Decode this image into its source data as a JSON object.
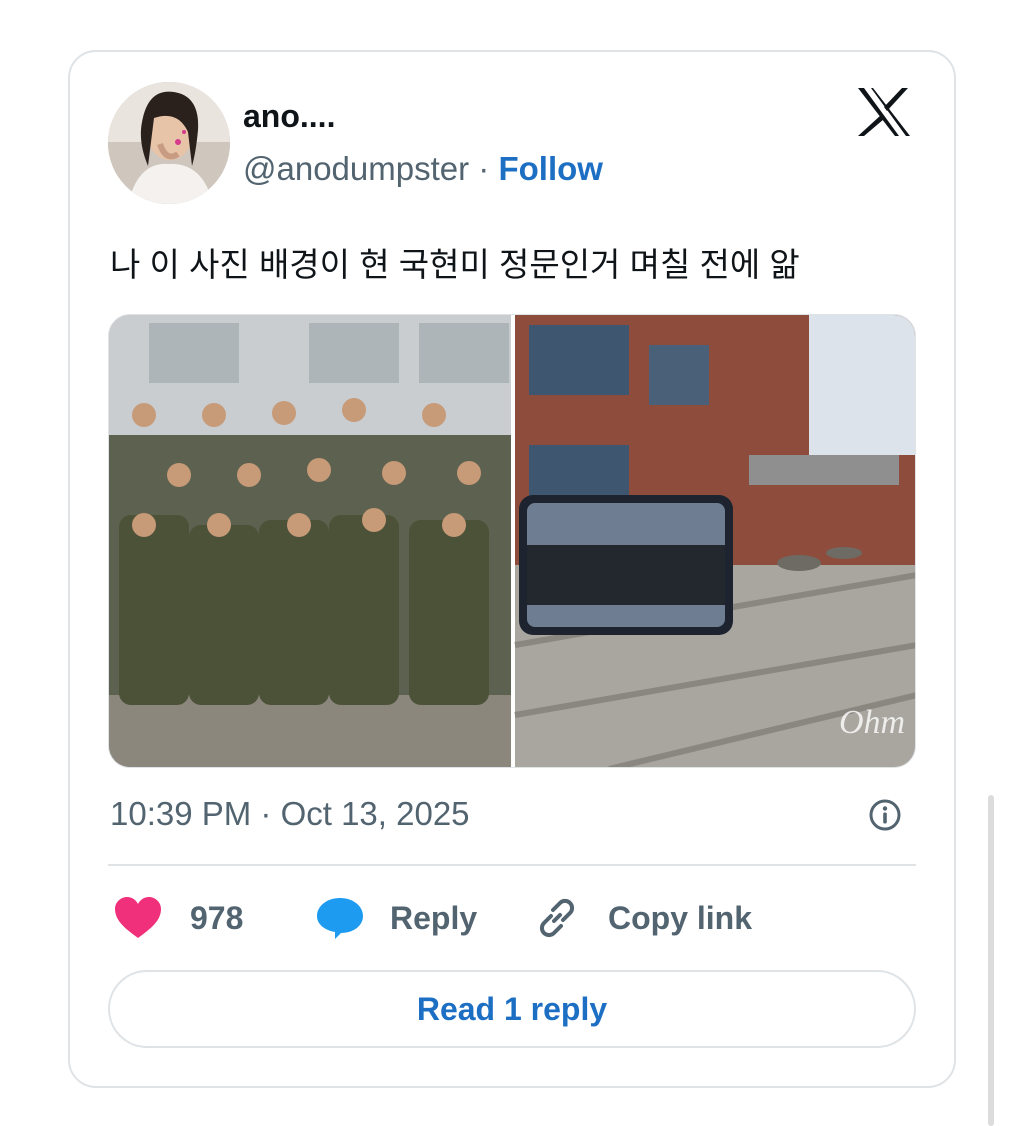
{
  "author": {
    "display_name": "ano....",
    "handle": "@anodumpster",
    "separator": "·",
    "follow_label": "Follow",
    "avatar_icon": "profile-photo"
  },
  "tweet": {
    "text": "나 이 사진 배경이 현 국현미 정문인거 며칠 전에 앎",
    "timestamp": "10:39 PM · Oct 13, 2025"
  },
  "media": {
    "watermark": "Ohm"
  },
  "actions": {
    "likes_count": "978",
    "reply_label": "Reply",
    "copy_link_label": "Copy link",
    "read_replies_label": "Read 1 reply"
  },
  "colors": {
    "accent": "#1d6fc4",
    "like": "#f0307a",
    "reply_icon": "#1d9bf0",
    "muted": "#536471"
  },
  "icons": [
    "x-logo-icon",
    "info-icon",
    "heart-icon",
    "speech-bubble-icon",
    "link-icon"
  ]
}
